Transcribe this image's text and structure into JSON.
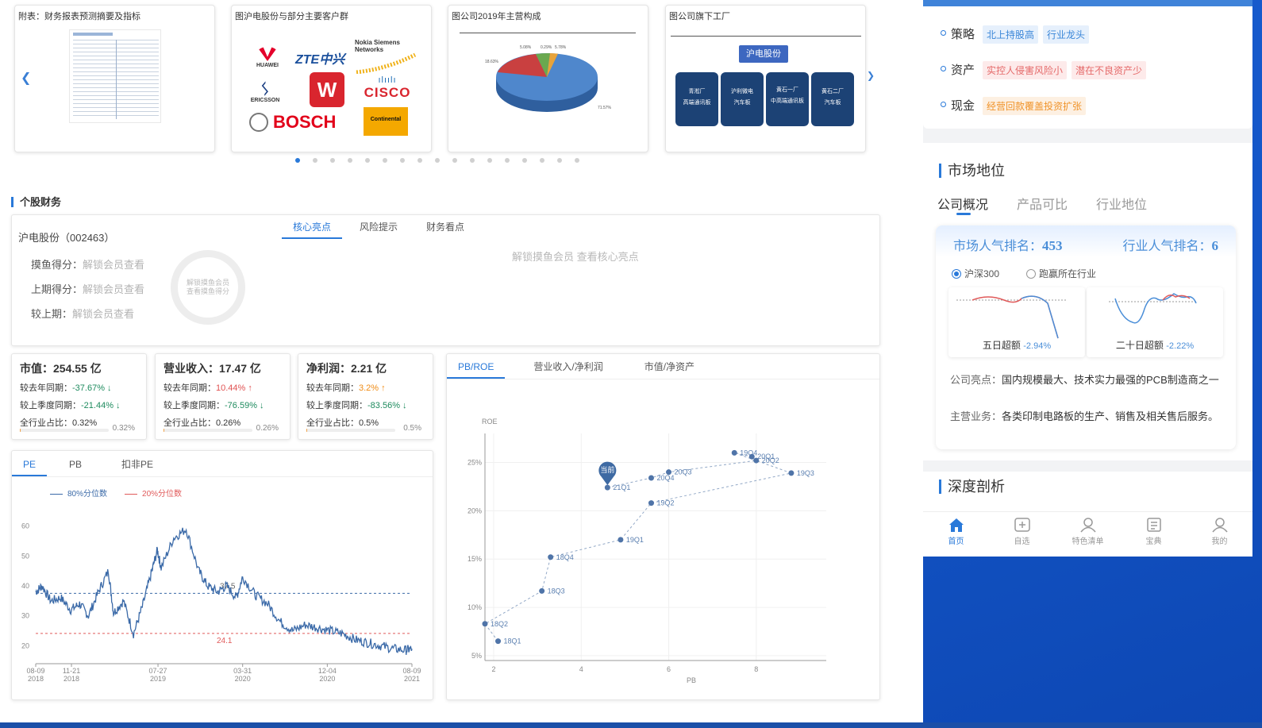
{
  "carousel": {
    "slides": [
      {
        "title": "附表：财务报表预测摘要及指标"
      },
      {
        "title": "图沪电股份与部分主要客户群",
        "logos": [
          "HUAWEI",
          "ZTE中兴",
          "Nokia Siemens Networks",
          "ERICSSON",
          "CISCO",
          "BOSCH",
          "Continental"
        ]
      },
      {
        "title": "图公司2019年主营构成"
      },
      {
        "title": "图公司旗下工厂",
        "root": "沪电股份",
        "factories": [
          "青淞厂\n高端通讯板",
          "沪利微电\n汽车板",
          "黄石一厂\n中高端通讯板",
          "黄石二厂\n汽车板"
        ]
      }
    ],
    "pie_labels": [
      "5.08%",
      "0.29%",
      "5.78%",
      "18.63%",
      "71.57%"
    ],
    "dot_count": 17,
    "active_dot": 0
  },
  "stock_finance": {
    "section_title": "个股财务",
    "stock_name": "沪电股份（002463）",
    "score_rows": [
      {
        "label": "摸鱼得分：",
        "value": "解锁会员查看"
      },
      {
        "label": "上期得分：",
        "value": "解锁会员查看"
      },
      {
        "label": "较上期：",
        "value": "解锁会员查看"
      }
    ],
    "gauge_text": "解锁摸鱼会员\n查看摸鱼得分",
    "tabs": [
      "核心亮点",
      "风险提示",
      "财务看点"
    ],
    "active_tab": 0,
    "locked_text": "解锁摸鱼会员 查看核心亮点"
  },
  "metrics": [
    {
      "head": "市值：254.55 亿",
      "yoy_label": "较去年同期：",
      "yoy": "-37.67%",
      "yoy_dir": "↓",
      "yoy_cls": "neg",
      "qoq_label": "较上季度同期：",
      "qoq": "-21.44%",
      "qoq_dir": "↓",
      "qoq_cls": "neg",
      "share_label": "全行业占比：",
      "share": "0.32%",
      "share_frac": 0.0032
    },
    {
      "head": "营业收入：17.47 亿",
      "yoy_label": "较去年同期：",
      "yoy": "10.44%",
      "yoy_dir": "↑",
      "yoy_cls": "pos",
      "qoq_label": "较上季度同期：",
      "qoq": "-76.59%",
      "qoq_dir": "↓",
      "qoq_cls": "neg",
      "share_label": "全行业占比：",
      "share": "0.26%",
      "share_frac": 0.0026
    },
    {
      "head": "净利润：2.21 亿",
      "yoy_label": "较去年同期：",
      "yoy": "3.2%",
      "yoy_dir": "↑",
      "yoy_cls": "orange",
      "qoq_label": "较上季度同期：",
      "qoq": "-83.56%",
      "qoq_dir": "↓",
      "qoq_cls": "neg",
      "share_label": "全行业占比：",
      "share": "0.5%",
      "share_frac": 0.005
    }
  ],
  "pe_panel": {
    "tabs": [
      "PE",
      "PB",
      "扣非PE"
    ],
    "active_tab": 0,
    "legend": [
      {
        "name": "80%分位数",
        "color": "#3b6aa8"
      },
      {
        "name": "20%分位数",
        "color": "#e05a5a"
      }
    ]
  },
  "pb_panel": {
    "tabs": [
      "PB/ROE",
      "营业收入/净利润",
      "市值/净资产"
    ],
    "active_tab": 0,
    "marker_label": "当前"
  },
  "chart_data": [
    {
      "type": "line",
      "title": "",
      "xlabel": "",
      "ylabel": "",
      "ylim": [
        14,
        66
      ],
      "yticks": [
        20,
        30,
        40,
        50,
        60
      ],
      "x_tick_labels": [
        [
          "08-09",
          "2018"
        ],
        [
          "11-21",
          "2018"
        ],
        [
          "07-27",
          "2019"
        ],
        [
          "03-31",
          "2020"
        ],
        [
          "12-04",
          "2020"
        ],
        [
          "08-09",
          "2021"
        ]
      ],
      "series": [
        {
          "name": "PE",
          "x": [
            2018.6,
            2018.65,
            2018.72,
            2018.8,
            2018.88,
            2018.95,
            2019.02,
            2019.1,
            2019.18,
            2019.22,
            2019.3,
            2019.38,
            2019.45,
            2019.52,
            2019.57,
            2019.6,
            2019.7,
            2019.8,
            2019.9,
            2019.97,
            2020.05,
            2020.12,
            2020.2,
            2020.25,
            2020.35,
            2020.45,
            2020.55,
            2020.65,
            2020.75,
            2020.85,
            2020.95,
            2021.05,
            2021.15,
            2021.25,
            2021.35,
            2021.45,
            2021.55,
            2021.6
          ],
          "values": [
            38,
            40,
            35,
            36,
            32,
            34,
            30,
            38,
            45,
            31,
            35,
            24,
            33,
            44,
            52,
            46,
            56,
            59,
            45,
            40,
            38,
            40,
            36,
            43,
            37,
            34,
            28,
            25,
            27,
            26,
            25,
            24,
            22,
            21,
            20,
            19,
            18.5,
            19
          ]
        },
        {
          "name": "80%分位数",
          "x": [
            2018.6,
            2021.6
          ],
          "values": [
            37.5,
            37.5
          ]
        },
        {
          "name": "20%分位数",
          "x": [
            2018.6,
            2021.6
          ],
          "values": [
            24.1,
            24.1
          ]
        }
      ],
      "annotations": [
        "37.5",
        "24.1"
      ]
    },
    {
      "type": "scatter",
      "title": "",
      "xlabel": "PB",
      "ylabel": "ROE",
      "xlim": [
        1.8,
        9.6
      ],
      "ylim": [
        4.5,
        28
      ],
      "xticks": [
        2,
        4,
        6,
        8
      ],
      "yticks": [
        5,
        10,
        15,
        20,
        25
      ],
      "y_tick_suffix": "%",
      "points": [
        {
          "label": "18Q1",
          "x": 2.1,
          "y": 6.5
        },
        {
          "label": "18Q2",
          "x": 1.8,
          "y": 8.3
        },
        {
          "label": "18Q3",
          "x": 3.1,
          "y": 11.7
        },
        {
          "label": "18Q4",
          "x": 3.3,
          "y": 15.2
        },
        {
          "label": "19Q1",
          "x": 4.9,
          "y": 17.0
        },
        {
          "label": "19Q2",
          "x": 5.6,
          "y": 20.8
        },
        {
          "label": "19Q3",
          "x": 8.8,
          "y": 23.9
        },
        {
          "label": "19Q4",
          "x": 7.5,
          "y": 26.0
        },
        {
          "label": "20Q1",
          "x": 7.9,
          "y": 25.6
        },
        {
          "label": "20Q2",
          "x": 8.0,
          "y": 25.2
        },
        {
          "label": "20Q3",
          "x": 6.0,
          "y": 24.0
        },
        {
          "label": "20Q4",
          "x": 5.6,
          "y": 23.4
        },
        {
          "label": "21Q1",
          "x": 4.6,
          "y": 22.4
        }
      ],
      "current": "21Q1"
    }
  ],
  "right_panel": {
    "tags_rows": [
      {
        "label": "策略",
        "tags": [
          {
            "text": "北上持股高",
            "cls": "blue"
          },
          {
            "text": "行业龙头",
            "cls": "blue"
          }
        ]
      },
      {
        "label": "资产",
        "tags": [
          {
            "text": "实控人侵害风险小",
            "cls": "red"
          },
          {
            "text": "潜在不良资产少",
            "cls": "red"
          }
        ]
      },
      {
        "label": "现金",
        "tags": [
          {
            "text": "经营回款覆盖投资扩张",
            "cls": "orange"
          }
        ]
      }
    ],
    "market_title": "市场地位",
    "market_tabs": [
      "公司概况",
      "产品可比",
      "行业地位"
    ],
    "active_market_tab": 0,
    "popularity_label": "市场人气排名：",
    "popularity_value": "453",
    "industry_label": "行业人气排名：",
    "industry_value": "6",
    "radio_options": [
      "沪深300",
      "跑赢所在行业"
    ],
    "radio_selected": 0,
    "mini_charts": [
      {
        "label": "五日超额",
        "value": "-2.94%"
      },
      {
        "label": "二十日超额",
        "value": "-2.22%"
      }
    ],
    "highlight_label": "公司亮点：",
    "highlight_text": "国内规模最大、技术实力最强的PCB制造商之一",
    "business_label": "主营业务：",
    "business_text": "各类印制电路板的生产、销售及相关售后服务。",
    "deep_title": "深度剖析",
    "nav": [
      {
        "label": "首页",
        "icon": "home-icon"
      },
      {
        "label": "自选",
        "icon": "add-box-icon"
      },
      {
        "label": "特色清单",
        "icon": "user-icon"
      },
      {
        "label": "宝典",
        "icon": "book-icon"
      },
      {
        "label": "我的",
        "icon": "profile-icon"
      }
    ],
    "active_nav": 0
  },
  "colors": {
    "accent": "#2979d9",
    "scatter": "#4f74a8",
    "pe_line": "#3b6aa8",
    "quantile_low": "#e05a5a"
  }
}
